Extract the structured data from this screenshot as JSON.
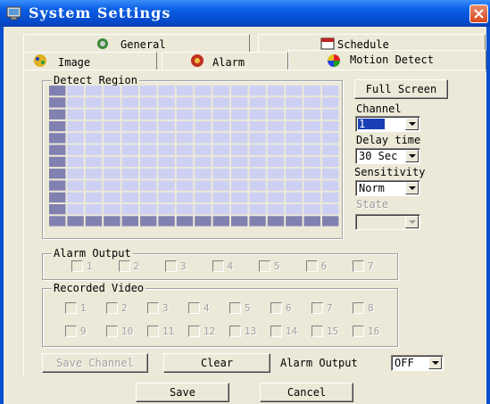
{
  "window": {
    "title": "System Settings"
  },
  "tabs": [
    {
      "label": "General"
    },
    {
      "label": "Schedule"
    },
    {
      "label": "Image"
    },
    {
      "label": "Alarm"
    },
    {
      "label": "Motion Detect"
    }
  ],
  "detect_region": {
    "label": "Detect Region"
  },
  "full_screen_button": "Full Screen",
  "channel": {
    "label": "Channel",
    "value": "1"
  },
  "delay_time": {
    "label": "Delay time",
    "value": "30 Sec"
  },
  "sensitivity": {
    "label": "Sensitivity",
    "value": "Norm"
  },
  "state": {
    "label": "State",
    "value": ""
  },
  "alarm_output_group": {
    "label": "Alarm Output",
    "items": [
      "1",
      "2",
      "3",
      "4",
      "5",
      "6",
      "7"
    ]
  },
  "recorded_video_group": {
    "label": "Recorded Video",
    "items": [
      "1",
      "2",
      "3",
      "4",
      "5",
      "6",
      "7",
      "8",
      "9",
      "10",
      "11",
      "12",
      "13",
      "14",
      "15",
      "16"
    ]
  },
  "save_channel_button": "Save Channel",
  "clear_button": "Clear",
  "alarm_output_select": {
    "label": "Alarm Output",
    "value": "OFF"
  },
  "save_button": "Save",
  "cancel_button": "Cancel",
  "colors": {
    "title_bar": "#0a5fe6",
    "grid_cell": "#cdd0f3",
    "grid_border": "#8081b0",
    "face": "#ece9d8"
  }
}
